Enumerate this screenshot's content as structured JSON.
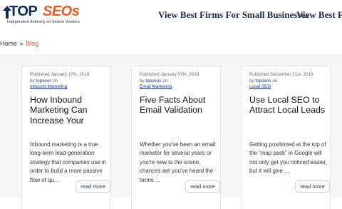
{
  "header": {
    "logo": {
      "brand_top": "TOP",
      "brand_seos": "SEOs",
      "tagline": "Independent Authority on Search Vendors"
    },
    "nav": [
      {
        "label": "View Best Firms For Small Businesses"
      },
      {
        "label": "View Best Firm"
      }
    ]
  },
  "breadcrumb": {
    "home": "Home",
    "separator": "»",
    "current": "Blog"
  },
  "posts": [
    {
      "published": "Published January 17th, 2019",
      "by": "by",
      "author": "topseos",
      "on": "on",
      "category": "Inbound Marketing",
      "title": "How Inbound Marketing Can Increase Your",
      "excerpt": "Inbound marketing is a true long-term lead-generation strategy that companies use in order to build a more passive flow of qu...",
      "read_more": "read more"
    },
    {
      "published": "Published January 07th, 2019",
      "by": "by",
      "author": "topseos",
      "on": "on",
      "category": "Email Marketing",
      "title": "Five Facts About Email Validation",
      "excerpt": "Whether you've been an email marketer for several years or you're new to the scene, chances are you've heard the terms ...",
      "read_more": "read more"
    },
    {
      "published": "Published December 21st, 2018",
      "by": "by",
      "author": "topseos",
      "on": "on",
      "category": "Local SEO",
      "title": "Use Local SEO to Attract Local Leads",
      "excerpt": "Getting positioned at the top of the “map pack” in Google will not only get you noticed easier, but it will give ...",
      "read_more": "read more"
    }
  ],
  "icons": {
    "logo_arrow": "up-arrow-icon",
    "nav_dropdown": "chevron-down-icon"
  },
  "colors": {
    "brand_navy": "#0d2b52",
    "brand_orange": "#e65c20",
    "breadcrumb_current": "#e0532c",
    "link": "#1a3a6b"
  }
}
